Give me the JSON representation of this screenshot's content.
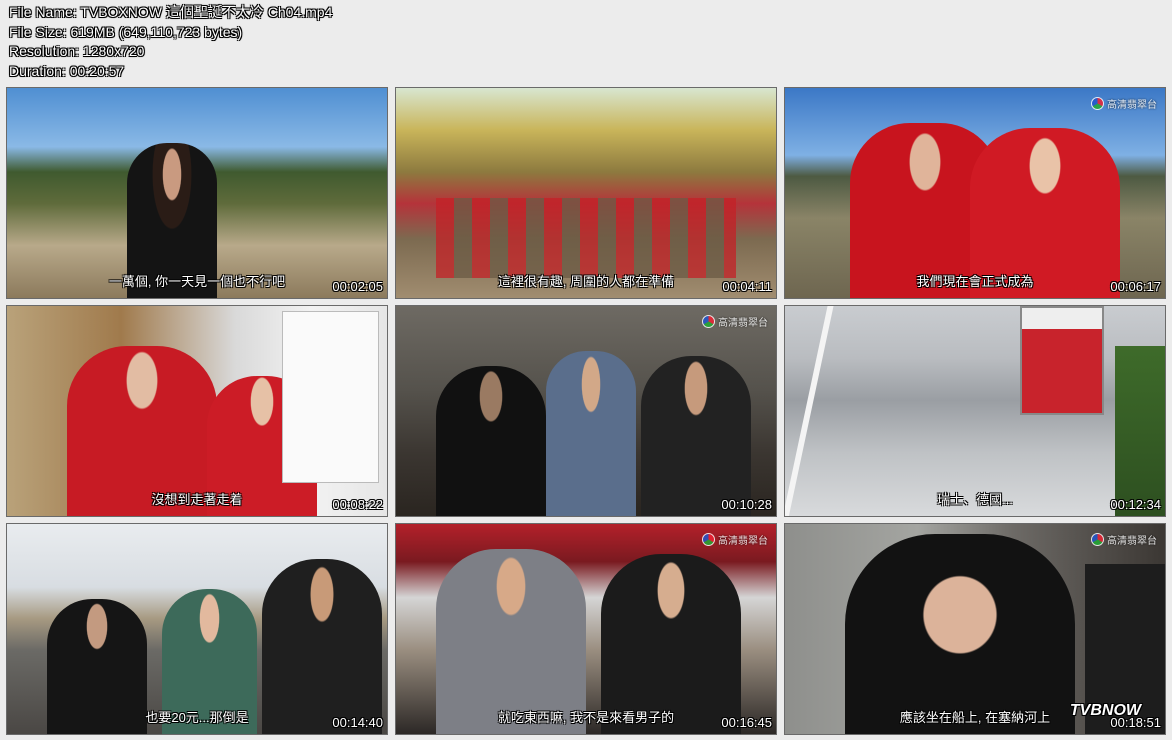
{
  "info": {
    "file_name": "File Name: TVBOXNOW 這個聖誕不太冷 Ch04.mp4",
    "file_size": "File Size: 619MB (649,110,723 bytes)",
    "resolution": "Resolution: 1280x720",
    "duration": "Duration: 00:20:57"
  },
  "channel_logo": "高清翡翠台",
  "watermark": "TVBNOW",
  "thumbnails": [
    {
      "subtitle": "一萬個, 你一天見一個也不行吧",
      "timestamp": "00:02:05",
      "logo": ""
    },
    {
      "subtitle": "這裡很有趣, 周圍的人都在準備",
      "timestamp": "00:04:11",
      "logo": ""
    },
    {
      "subtitle": "我們現在會正式成為",
      "timestamp": "00:06:17",
      "logo": "高清翡翠台"
    },
    {
      "subtitle": "沒想到走著走着",
      "timestamp": "00:08:22",
      "logo": ""
    },
    {
      "subtitle": "",
      "timestamp": "00:10:28",
      "logo": "高清翡翠台"
    },
    {
      "subtitle": "瑞士、德國...",
      "timestamp": "00:12:34",
      "logo": ""
    },
    {
      "subtitle": "也要20元...那倒是",
      "timestamp": "00:14:40",
      "logo": ""
    },
    {
      "subtitle": "就吃東西嘛, 我不是來看男子的",
      "timestamp": "00:16:45",
      "logo": "高清翡翠台"
    },
    {
      "subtitle": "應該坐在船上, 在塞納河上",
      "timestamp": "00:18:51",
      "logo": "高清翡翠台"
    }
  ]
}
